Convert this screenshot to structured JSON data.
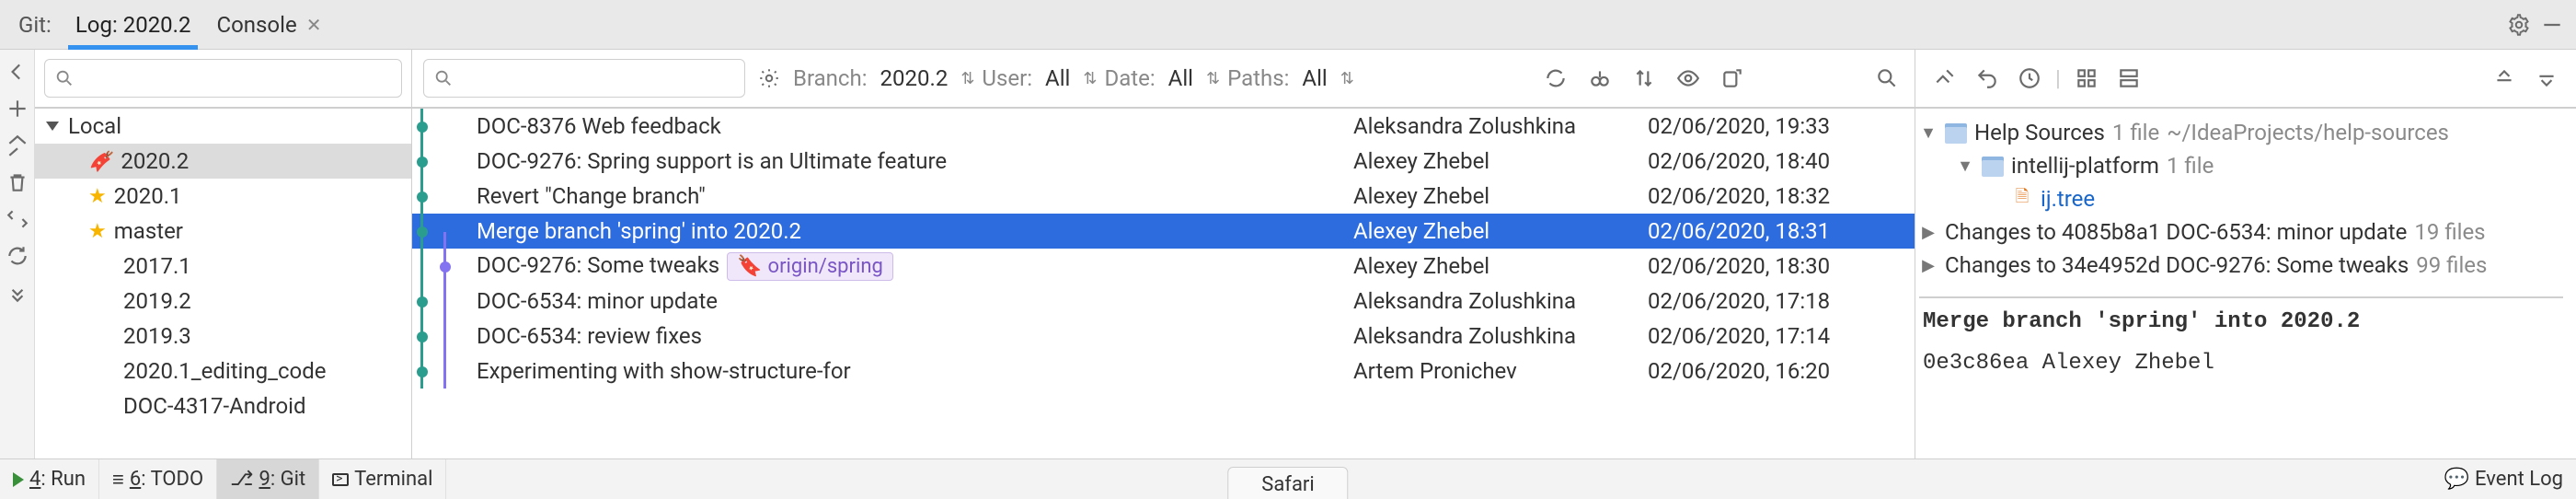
{
  "topbar": {
    "prefix": "Git:",
    "tabs": [
      {
        "label": "Log: 2020.2",
        "active": true,
        "closable": false
      },
      {
        "label": "Console",
        "active": false,
        "closable": true
      }
    ]
  },
  "gutter_icons": [
    "nav-back-icon",
    "add-icon",
    "expand-icon",
    "delete-icon",
    "diff-icon",
    "refresh-icon",
    "more-icon"
  ],
  "branches": {
    "search_placeholder": "",
    "root_label": "Local",
    "items": [
      {
        "label": "2020.2",
        "icon": "tag",
        "selected": true
      },
      {
        "label": "2020.1",
        "icon": "star"
      },
      {
        "label": "master",
        "icon": "star"
      },
      {
        "label": "2017.1"
      },
      {
        "label": "2019.2"
      },
      {
        "label": "2019.3"
      },
      {
        "label": "2020.1_editing_code"
      },
      {
        "label": "DOC-4317-Android"
      }
    ]
  },
  "filters": {
    "branch": {
      "key": "Branch:",
      "value": "2020.2"
    },
    "user": {
      "key": "User:",
      "value": "All"
    },
    "date": {
      "key": "Date:",
      "value": "All"
    },
    "paths": {
      "key": "Paths:",
      "value": "All"
    }
  },
  "filter_tool_icons": [
    "sync-icon",
    "cherrypick-icon",
    "sort-icon",
    "preview-icon",
    "newbranch-icon",
    "search-icon"
  ],
  "commits": [
    {
      "message": "DOC-8376 Web feedback",
      "author": "Aleksandra Zolushkina",
      "date": "02/06/2020, 19:33",
      "selected": false
    },
    {
      "message": "DOC-9276: Spring support is an Ultimate feature",
      "author": "Alexey Zhebel",
      "date": "02/06/2020, 18:40",
      "selected": false
    },
    {
      "message": "Revert \"Change branch\"",
      "author": "Alexey Zhebel",
      "date": "02/06/2020, 18:32",
      "selected": false
    },
    {
      "message": "Merge branch 'spring' into 2020.2",
      "author": "Alexey Zhebel",
      "date": "02/06/2020, 18:31",
      "selected": true
    },
    {
      "message": "DOC-9276: Some tweaks",
      "author": "Alexey Zhebel",
      "date": "02/06/2020, 18:30",
      "selected": false,
      "ref": "origin/spring"
    },
    {
      "message": "DOC-6534: minor update",
      "author": "Aleksandra Zolushkina",
      "date": "02/06/2020, 17:18",
      "selected": false
    },
    {
      "message": "DOC-6534: review fixes",
      "author": "Aleksandra Zolushkina",
      "date": "02/06/2020, 17:14",
      "selected": false
    },
    {
      "message": "Experimenting with show-structure-for",
      "author": "Artem Pronichev",
      "date": "02/06/2020, 16:20",
      "selected": false
    }
  ],
  "details": {
    "toolbar_icons": [
      "highlight-icon",
      "undo-icon",
      "history-icon",
      "group-icon",
      "expandall-icon",
      "collapseall-icon",
      "settings-icon"
    ],
    "tree": {
      "root": {
        "label": "Help Sources",
        "meta_count": "1 file",
        "meta_path": "~/IdeaProjects/help-sources"
      },
      "child": {
        "label": "intellij-platform",
        "meta_count": "1 file"
      },
      "file": {
        "label": "ij.tree"
      }
    },
    "change_groups": [
      {
        "label": "Changes to 4085b8a1 DOC-6534: minor update",
        "count": "19 files"
      },
      {
        "label": "Changes to 34e4952d DOC-9276: Some tweaks",
        "count": "99 files"
      }
    ],
    "commit_title": "Merge branch 'spring' into 2020.2",
    "commit_hash": "0e3c86ea",
    "commit_author": "Alexey Zhebel"
  },
  "status": {
    "run": {
      "key": "4",
      "label": ": Run"
    },
    "todo": {
      "key": "6",
      "label": ": TODO"
    },
    "git": {
      "key": "9",
      "label": ": Git"
    },
    "terminal": "Terminal",
    "eventlog": "Event Log",
    "browser_tab": "Safari"
  }
}
